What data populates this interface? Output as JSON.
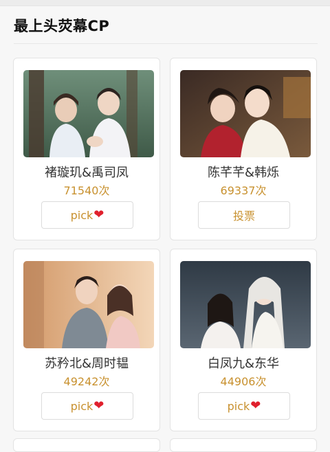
{
  "section": {
    "title": "最上头荧幕CP"
  },
  "cards": [
    {
      "name": "褚璇玑&禹司凤",
      "votes": "71540次",
      "button_label": "pick",
      "button_icon": "heart-icon"
    },
    {
      "name": "陈芊芊&韩烁",
      "votes": "69337次",
      "button_label": "投票",
      "button_icon": ""
    },
    {
      "name": "苏矜北&周时韫",
      "votes": "49242次",
      "button_label": "pick",
      "button_icon": "heart-icon"
    },
    {
      "name": "白凤九&东华",
      "votes": "44906次",
      "button_label": "pick",
      "button_icon": "heart-icon"
    }
  ],
  "colors": {
    "vote_text": "#c8912f",
    "heart": "#e0202d",
    "card_border": "#e3e3e3",
    "page_bg": "#f7f7f7"
  }
}
